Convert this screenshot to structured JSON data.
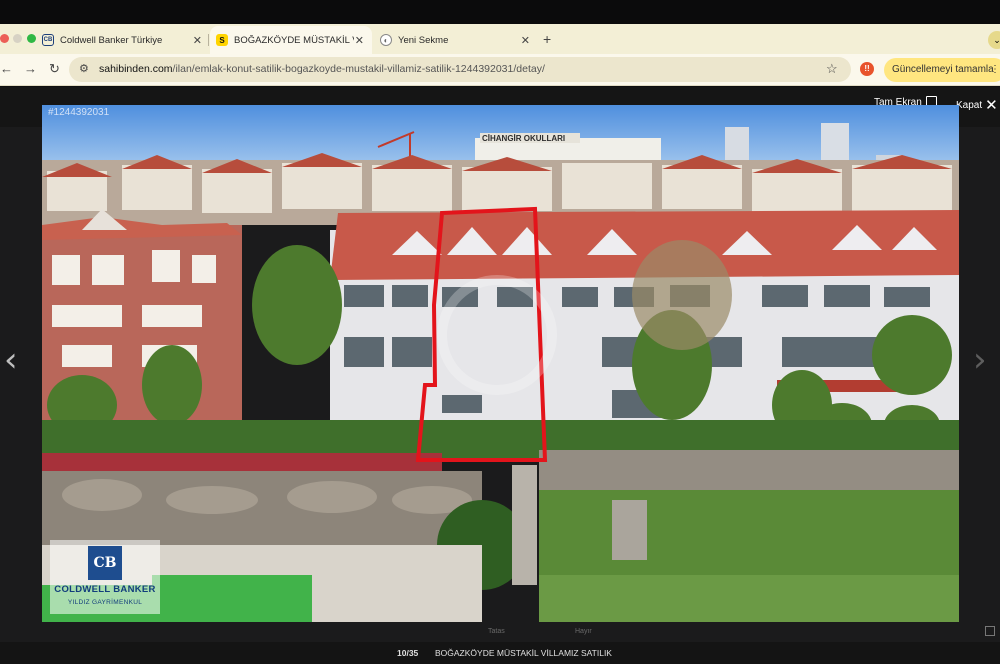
{
  "browser": {
    "tabs": [
      {
        "label": "Coldwell Banker Türkiye",
        "favicon": "coldwell-banker-icon",
        "active": false
      },
      {
        "label": "BOĞAZKÖYDE MÜSTAKİL VİL",
        "favicon": "sahibinden-icon",
        "active": true
      },
      {
        "label": "Yeni Sekme",
        "favicon": "chrome-icon",
        "active": false
      }
    ],
    "new_tab_label": "+",
    "url_host": "sahibinden.com",
    "url_path": "/ilan/emlak-konut-satilik-bogazkoyde-mustakil-villamiz-satilik-1244392031/detay/",
    "update_button_label": "Güncellemeyi tamamla",
    "extension_badge": "!!",
    "accent_color": "#ffe680"
  },
  "lightbox": {
    "fullscreen_label": "Tam Ekran",
    "close_label": "Kapat",
    "ad_id": "#1244392031",
    "prev_arrow": "‹",
    "next_arrow": "›",
    "counter": "10/35",
    "caption": "BOĞAZKÖYDE MÜSTAKİL VİLLAMIZ SATILIK",
    "footer_labels": [
      "Tatas",
      "Hayır"
    ],
    "watermark_logo": {
      "mark": "CB",
      "name": "COLDWELL BANKER",
      "subtitle": "YILDIZ GAYRİMENKUL"
    },
    "photo_signs": {
      "school_sign": "CİHANGİR OKULLARI"
    },
    "highlight_color": "#e3141b"
  }
}
